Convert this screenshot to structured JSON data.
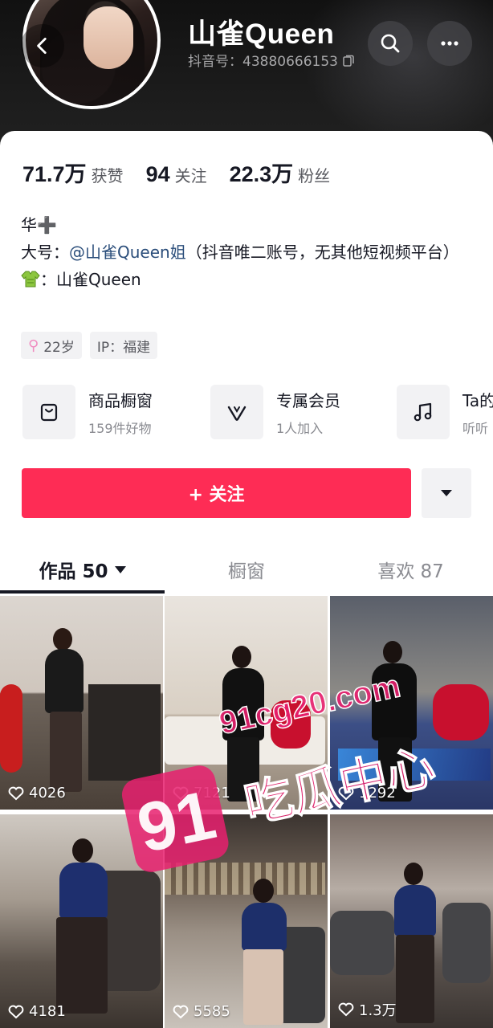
{
  "profile": {
    "name": "山雀Queen",
    "douyin_id": "抖音号：43880666153"
  },
  "stats": [
    {
      "num": "71.7万",
      "label": "获赞"
    },
    {
      "num": "94",
      "label": "关注"
    },
    {
      "num": "22.3万",
      "label": "粉丝"
    }
  ],
  "bio": {
    "line1": "华➕",
    "line2_prefix": "大号：",
    "line2_mention": "@山雀Queen姐",
    "line2_suffix": "（抖音唯二账号，无其他短视频平台）",
    "line3": "：山雀Queen"
  },
  "tags": {
    "age": "22岁",
    "ip": "IP：福建"
  },
  "services": [
    {
      "title": "商品橱窗",
      "sub": "159件好物",
      "icon": "bag-icon"
    },
    {
      "title": "专属会员",
      "sub": "1人加入",
      "icon": "v-badge-icon"
    },
    {
      "title": "Ta的",
      "sub": "听听",
      "icon": "music-note-icon"
    }
  ],
  "follow": {
    "label": "+ 关注",
    "accent": "#fe2c55"
  },
  "tabs": [
    {
      "label": "作品 50"
    },
    {
      "label": "橱窗"
    },
    {
      "label": "喜欢 87"
    }
  ],
  "videos": [
    {
      "likes": "4026"
    },
    {
      "likes": "7121"
    },
    {
      "likes": "1292"
    },
    {
      "likes": "4181"
    },
    {
      "likes": "5585"
    },
    {
      "likes": "1.3万"
    }
  ],
  "watermark": {
    "url": "91cg20.com",
    "number": "91",
    "text": "吃瓜中心"
  }
}
